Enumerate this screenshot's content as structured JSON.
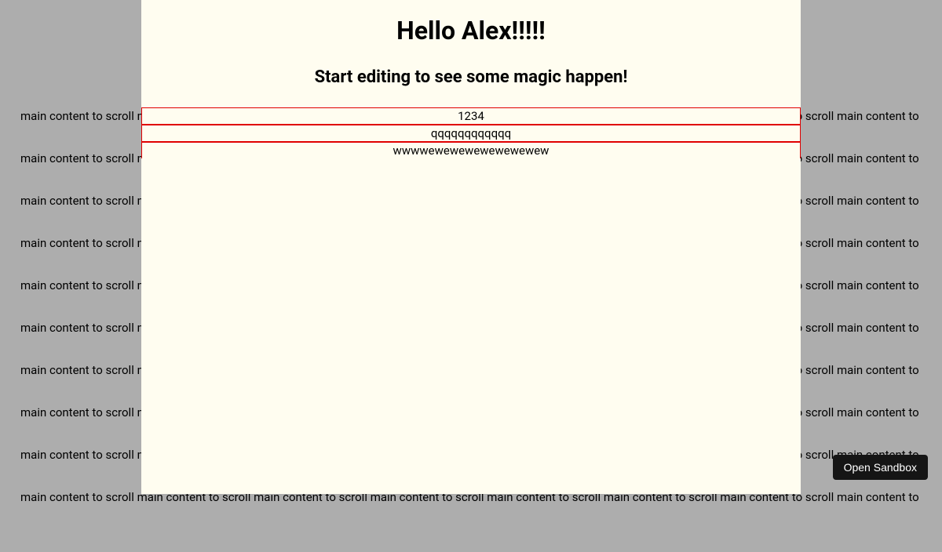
{
  "background": {
    "repeating_text": "main content to scroll main content to scroll main content to scroll main content to scroll main content to scroll main content to scroll main content to scroll main content to scroll main content to",
    "rows": 10
  },
  "overlay": {
    "title": "Hello Alex!!!!!",
    "subtitle": "Start editing to see some magic happen!",
    "items": [
      "1234",
      "qqqqqqqqqqqq",
      "wwwwewewewewewewewew"
    ]
  },
  "button": {
    "open_sandbox": "Open Sandbox"
  }
}
